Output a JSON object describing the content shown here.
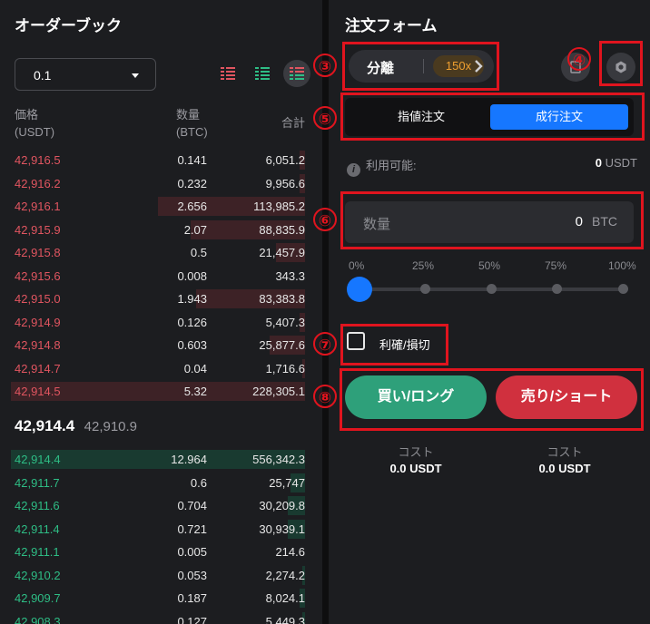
{
  "orderbook": {
    "title": "オーダーブック",
    "precision": "0.1",
    "headers": {
      "price": "価格",
      "price_unit": "(USDT)",
      "amount": "数量",
      "amount_unit": "(BTC)",
      "total": "合計"
    },
    "asks": [
      {
        "price": "42,916.5",
        "amount": "0.141",
        "total": "6,051.2",
        "depth": 0.02
      },
      {
        "price": "42,916.2",
        "amount": "0.232",
        "total": "9,956.6",
        "depth": 0.02
      },
      {
        "price": "42,916.1",
        "amount": "2.656",
        "total": "113,985.2",
        "depth": 0.5
      },
      {
        "price": "42,915.9",
        "amount": "2.07",
        "total": "88,835.9",
        "depth": 0.39
      },
      {
        "price": "42,915.8",
        "amount": "0.5",
        "total": "21,457.9",
        "depth": 0.1
      },
      {
        "price": "42,915.6",
        "amount": "0.008",
        "total": "343.3",
        "depth": 0.0
      },
      {
        "price": "42,915.0",
        "amount": "1.943",
        "total": "83,383.8",
        "depth": 0.37
      },
      {
        "price": "42,914.9",
        "amount": "0.126",
        "total": "5,407.3",
        "depth": 0.02
      },
      {
        "price": "42,914.8",
        "amount": "0.603",
        "total": "25,877.6",
        "depth": 0.12
      },
      {
        "price": "42,914.7",
        "amount": "0.04",
        "total": "1,716.6",
        "depth": 0.01
      },
      {
        "price": "42,914.5",
        "amount": "5.32",
        "total": "228,305.1",
        "depth": 1.0
      }
    ],
    "last_price": "42,914.4",
    "mark_price": "42,910.9",
    "bids": [
      {
        "price": "42,914.4",
        "amount": "12.964",
        "total": "556,342.3",
        "depth": 1.0
      },
      {
        "price": "42,911.7",
        "amount": "0.6",
        "total": "25,747",
        "depth": 0.05
      },
      {
        "price": "42,911.6",
        "amount": "0.704",
        "total": "30,209.8",
        "depth": 0.06
      },
      {
        "price": "42,911.4",
        "amount": "0.721",
        "total": "30,939.1",
        "depth": 0.06
      },
      {
        "price": "42,911.1",
        "amount": "0.005",
        "total": "214.6",
        "depth": 0.0
      },
      {
        "price": "42,910.2",
        "amount": "0.053",
        "total": "2,274.2",
        "depth": 0.01
      },
      {
        "price": "42,909.7",
        "amount": "0.187",
        "total": "8,024.1",
        "depth": 0.02
      },
      {
        "price": "42,908.3",
        "amount": "0.127",
        "total": "5,449.3",
        "depth": 0.01
      }
    ]
  },
  "order_form": {
    "title": "注文フォーム",
    "margin_mode": "分離",
    "leverage": "150x",
    "order_types": [
      "指値注文",
      "成行注文"
    ],
    "active_order_type": 1,
    "available_label": "利用可能:",
    "available_value": "0",
    "available_unit": "USDT",
    "qty_placeholder": "数量",
    "qty_value": "0",
    "qty_unit": "BTC",
    "slider_marks": [
      "0%",
      "25%",
      "50%",
      "75%",
      "100%"
    ],
    "slider_value": 0,
    "tpsl_label": "利確/損切",
    "buy_label": "買い/ロング",
    "sell_label": "売り/ショート",
    "cost_label": "コスト",
    "buy_cost": "0.0 USDT",
    "sell_cost": "0.0 USDT"
  },
  "annotations": [
    "③",
    "④",
    "⑤",
    "⑥",
    "⑦",
    "⑧"
  ],
  "colors": {
    "ask": "#e05560",
    "bid": "#2ebd85",
    "accent": "#1677ff",
    "annotation": "#e0141e"
  }
}
